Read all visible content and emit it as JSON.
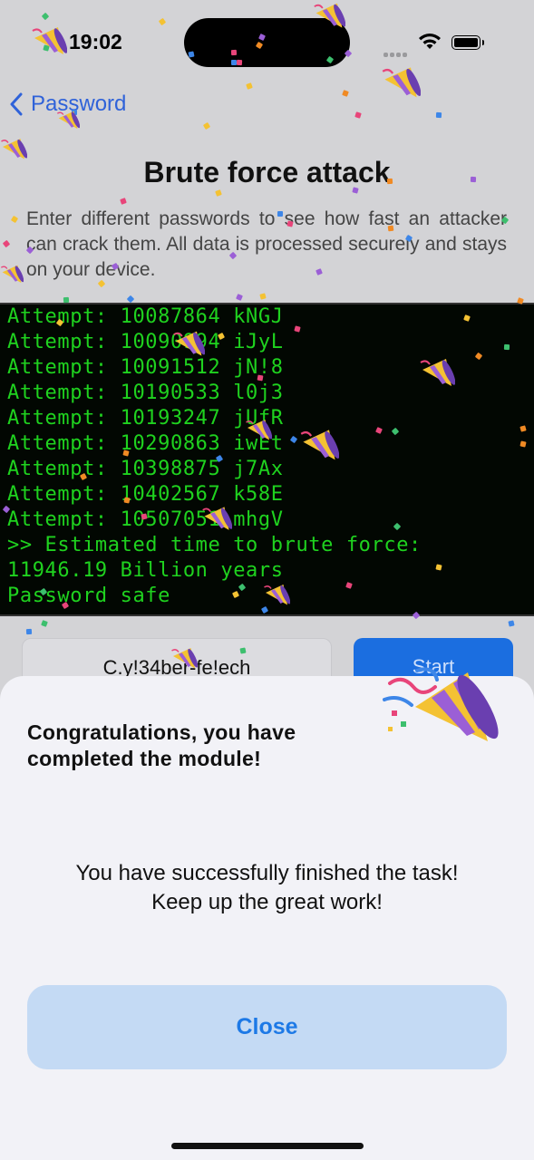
{
  "status_bar": {
    "time": "19:02"
  },
  "nav": {
    "back_label": "Password"
  },
  "page": {
    "title": "Brute force attack",
    "description": "Enter different passwords to see how fast an attacker can crack them. All data is processed securely and stays on your device."
  },
  "terminal": {
    "lines": [
      "Attempt: 10087864 kNGJ",
      "Attempt: 10090994 iJyL",
      "Attempt: 10091512 jN!8",
      "Attempt: 10190533 l0j3",
      "Attempt: 10193247 jUfR",
      "Attempt: 10290863 iwEt",
      "Attempt: 10398875 j7Ax",
      "Attempt: 10402567 k58E",
      "Attempt: 10507051 mhgV",
      ">> Estimated time to brute force:",
      "11946.19 Billion years",
      "Password safe"
    ]
  },
  "controls": {
    "password_value": "C.y!34ber-fe!ech",
    "start_label": "Start"
  },
  "sheet": {
    "heading": "Congratulations, you have completed the module!",
    "message_line1": "You have successfully finished the task!",
    "message_line2": "Keep up the great work!",
    "close_label": "Close",
    "icon": "party-popper-icon"
  },
  "colors": {
    "accent": "#1b6ee0",
    "terminal_text": "#1fd21f",
    "terminal_bg": "#020702",
    "close_bg": "#c4daf4",
    "close_text": "#1d79e6"
  }
}
